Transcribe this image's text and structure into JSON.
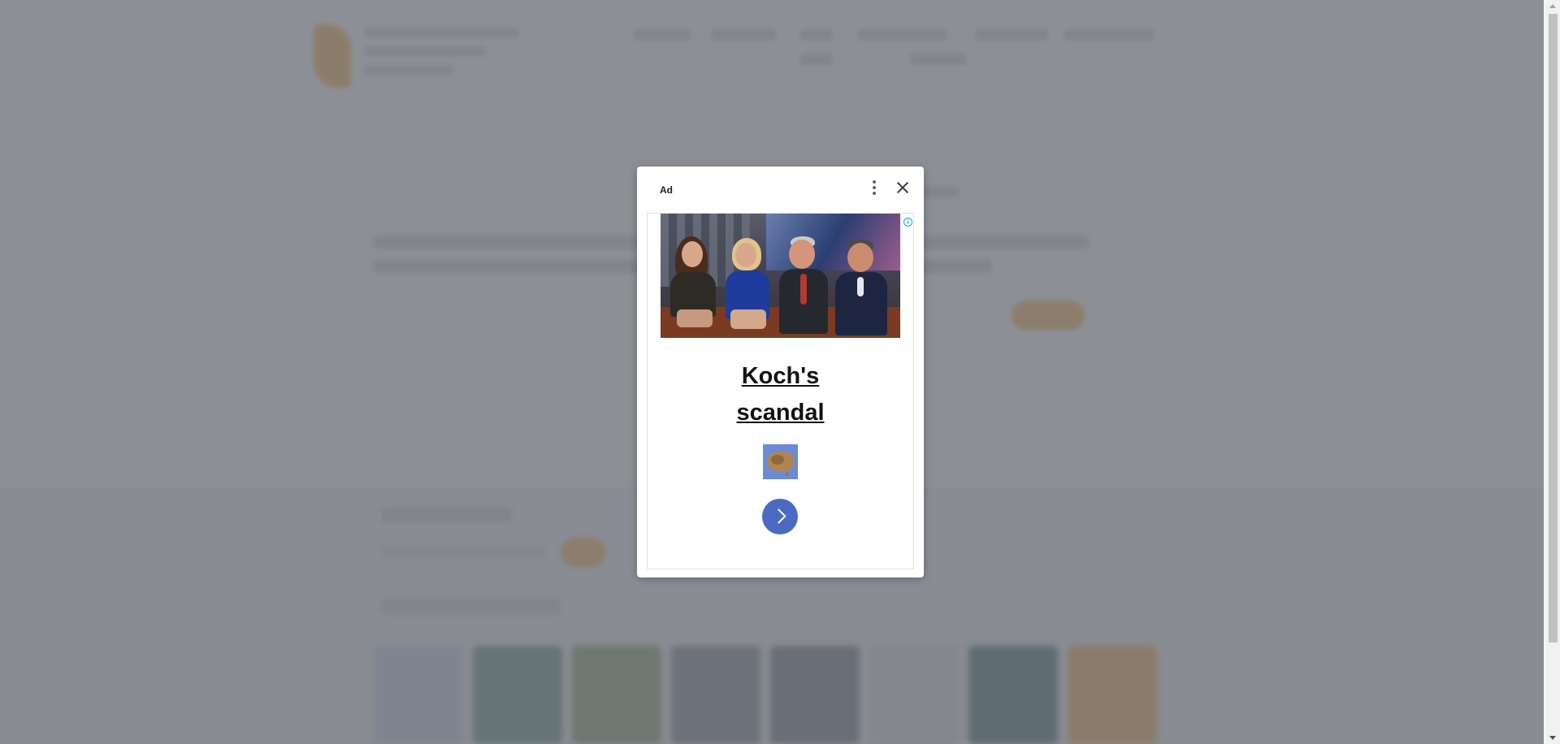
{
  "ad": {
    "label": "Ad",
    "menu_icon": "more-vert-icon",
    "close_icon": "close-icon",
    "info_icon": "info-icon",
    "info_glyph": "i",
    "headline_line1": "Koch's",
    "headline_line2": "scandal",
    "thumbnail_icon": "australia-map-icon",
    "cta_icon": "chevron-right-icon"
  },
  "colors": {
    "overlay": "#6e7278",
    "cta": "#4b6bc2",
    "info": "#00aecd",
    "accent_background": "#f0a84a"
  }
}
